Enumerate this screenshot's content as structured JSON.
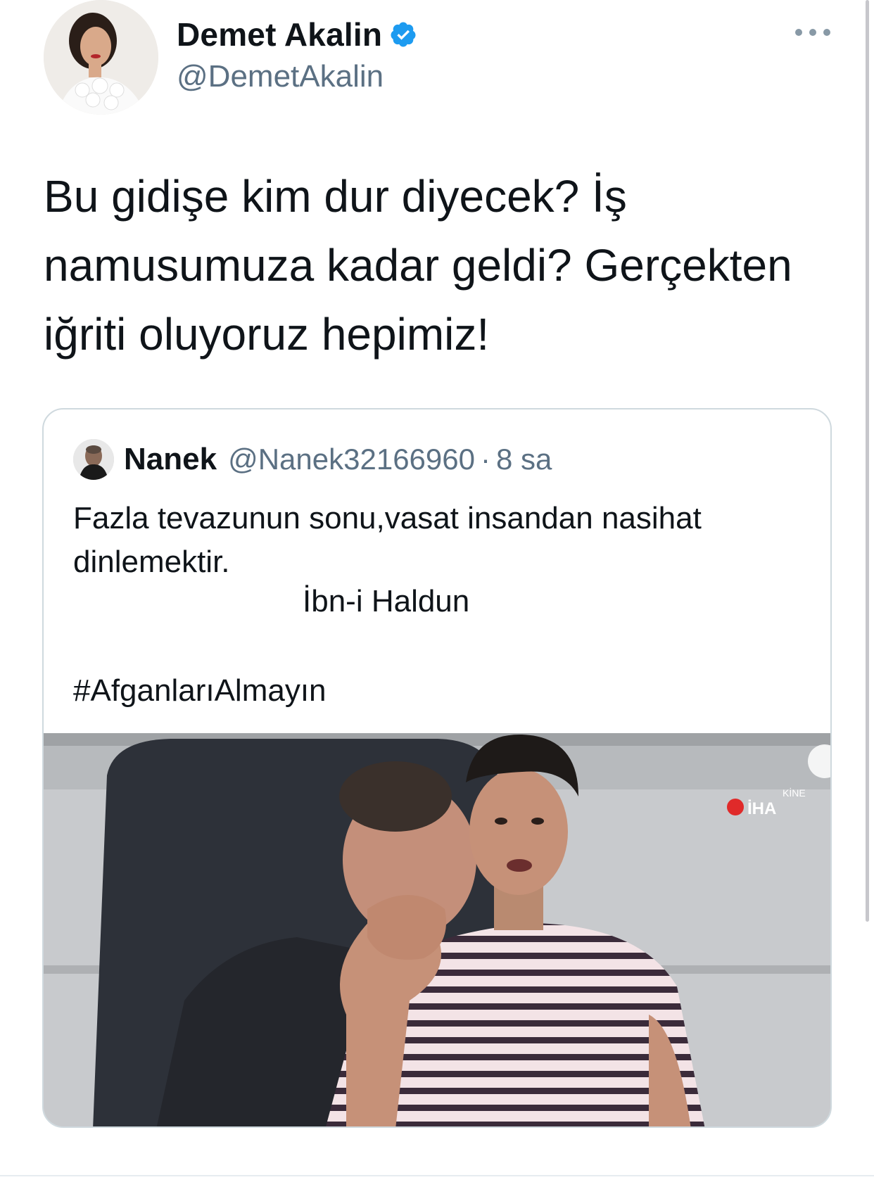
{
  "tweet": {
    "display_name": "Demet Akalin",
    "handle": "@DemetAkalin",
    "verified": true,
    "text_lines": [
      "Bu gidişe kim dur diyecek? İş",
      "namusumuza kadar geldi? Gerçekten",
      "iğriti oluyoruz hepimiz!"
    ]
  },
  "quoted": {
    "display_name": "Nanek",
    "handle": "@Nanek32166960",
    "separator": "·",
    "time": "8 sa",
    "body_lines": [
      "Fazla tevazunun sonu,vasat insandan nasihat",
      "dinlemektir."
    ],
    "author": "İbn-i Haldun",
    "hashtag": "#AfganlarıAlmayın",
    "media": {
      "watermark": "İHA",
      "corner_text": "KİNE"
    }
  },
  "colors": {
    "text": "#0f1419",
    "secondary": "#5b7083",
    "verified": "#1d9bf0",
    "border": "#cfd9de"
  },
  "icons": {
    "verified": "verified-badge-icon",
    "more": "more-horizontal-icon"
  }
}
